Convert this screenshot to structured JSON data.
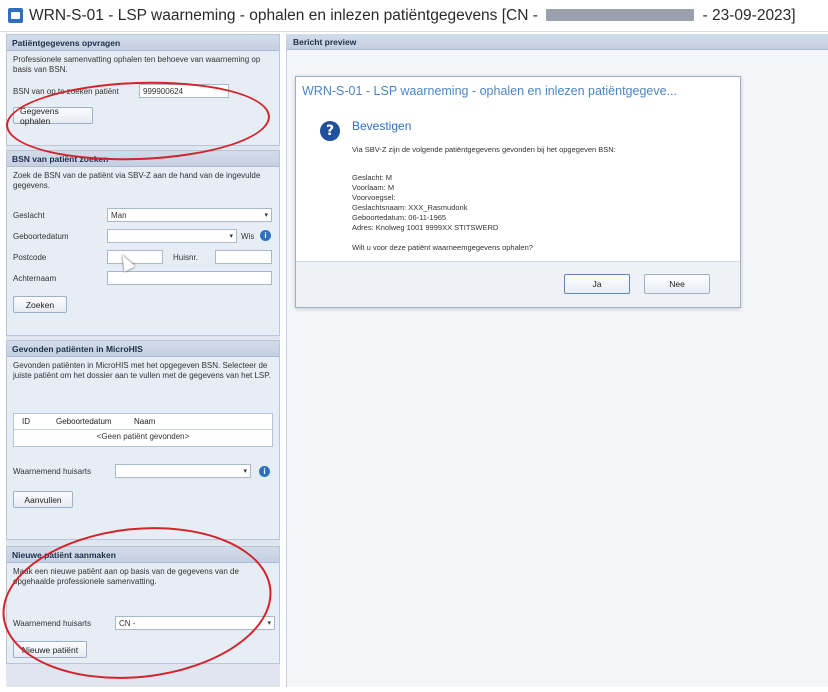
{
  "window": {
    "title_prefix": "WRN-S-01 - LSP waarneming - ophalen en inlezen patiëntgegevens",
    "title_cn": "[CN -",
    "title_date": "- 23-09-2023]"
  },
  "patient_request": {
    "header": "Patiëntgegevens opvragen",
    "description": "Professionele samenvatting ophalen ten behoeve van waarneming op basis van BSN.",
    "bsn_label": "BSN van op te zoeken patiënt",
    "bsn_value": "999900624",
    "fetch_button": "Gegevens ophalen"
  },
  "bsn_search": {
    "header": "BSN van patiënt zoeken",
    "description": "Zoek de BSN van de patiënt via SBV-Z aan de hand van de ingevulde gegevens.",
    "gender_label": "Geslacht",
    "gender_value": "Man",
    "birthdate_label": "Geboortedatum",
    "wis_label": "Wis",
    "postcode_label": "Postcode",
    "housenumber_label": "Huisnr.",
    "lastname_label": "Achternaam",
    "search_button": "Zoeken"
  },
  "found_patients": {
    "header": "Gevonden patiënten in MicroHIS",
    "description": "Gevonden patiënten in MicroHIS met het opgegeven BSN. Selecteer de juiste patiënt om het dossier aan te vullen met de gegevens van het LSP.",
    "col_id": "ID",
    "col_birthdate": "Geboortedatum",
    "col_name": "Naam",
    "empty": "<Geen patiënt gevonden>",
    "gp_label": "Waarnemend huisarts",
    "complete_button": "Aanvullen"
  },
  "new_patient": {
    "header": "Nieuwe patiënt aanmaken",
    "description": "Maak een nieuwe patiënt aan op basis van de gegevens van de opgehaalde professionele samenvatting.",
    "gp_label": "Waarnemend huisarts",
    "gp_value": "CN -",
    "new_button": "Nieuwe patiënt"
  },
  "preview": {
    "header": "Bericht preview"
  },
  "dialog": {
    "title": "WRN-S-01 - LSP waarneming - ophalen en inlezen patiëntgegeve...",
    "heading": "Bevestigen",
    "intro": "Via SBV-Z zijn de volgende patiëntgegevens gevonden bij het opgegeven BSN:",
    "gender": "Geslacht: M",
    "initials": "Voorlaam: M",
    "prefix": "Voorvoegsel:",
    "surname": "Geslachtsnaam: XXX_Rasmudonk",
    "birthdate": "Geboortedatum: 06-11-1965",
    "address": "Adres: Knolweg 1001 9999XX STITSWERD",
    "question": "Wilt u voor deze patiënt waarneemgegevens ophalen?",
    "yes_button": "Ja",
    "no_button": "Nee"
  },
  "colors": {
    "accent": "#2f6fc0",
    "annotation": "#d2232a",
    "panel": "#e7edf5"
  }
}
